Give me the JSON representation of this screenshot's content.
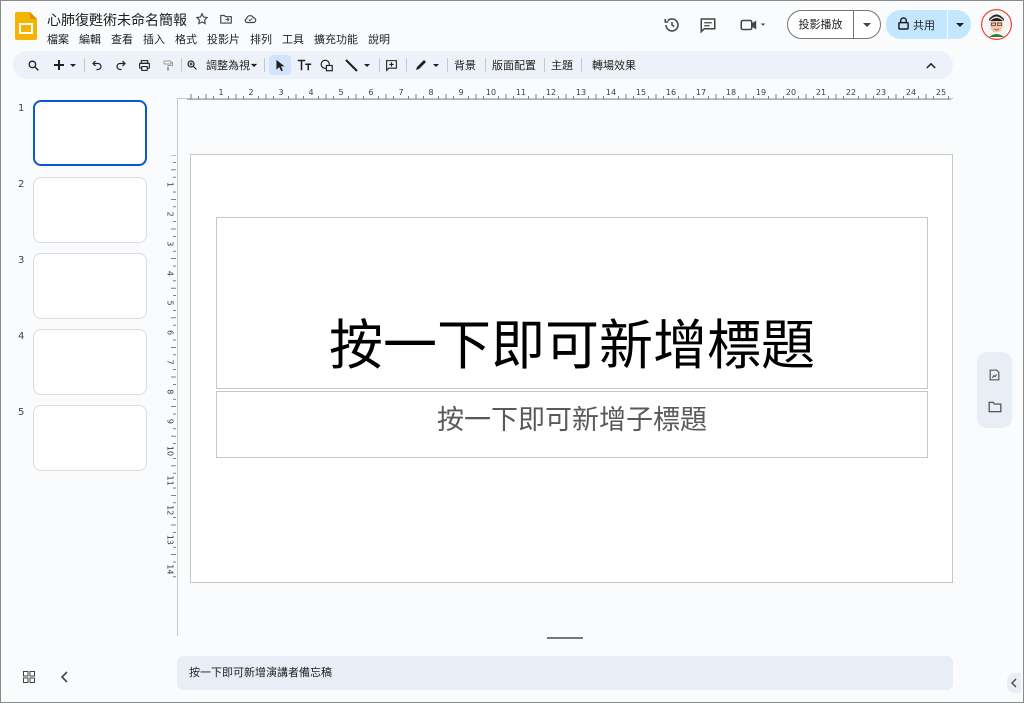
{
  "app": {
    "doc_title": "心肺復甦術未命名簡報",
    "menu": [
      "檔案",
      "編輯",
      "查看",
      "插入",
      "格式",
      "投影片",
      "排列",
      "工具",
      "擴充功能",
      "說明"
    ]
  },
  "header": {
    "present_label": "投影播放",
    "share_label": "共用",
    "accent": "#c2e7ff"
  },
  "toolbar": {
    "zoom_label": "調整為視",
    "background_label": "背景",
    "layout_label": "版面配置",
    "theme_label": "主題",
    "transition_label": "轉場效果"
  },
  "filmstrip": {
    "slides": [
      {
        "num": "1",
        "selected": true
      },
      {
        "num": "2",
        "selected": false
      },
      {
        "num": "3",
        "selected": false
      },
      {
        "num": "4",
        "selected": false
      },
      {
        "num": "5",
        "selected": false
      }
    ]
  },
  "rulers": {
    "horizontal": [
      "1",
      "2",
      "3",
      "4",
      "5",
      "6",
      "7",
      "8",
      "9",
      "10",
      "11",
      "12",
      "13",
      "14",
      "15",
      "16",
      "17",
      "18",
      "19",
      "20",
      "21",
      "22",
      "23",
      "24",
      "25"
    ],
    "vertical": [
      "1",
      "2",
      "3",
      "4",
      "5",
      "6",
      "7",
      "8",
      "9",
      "10",
      "11",
      "12",
      "13",
      "14"
    ]
  },
  "slide": {
    "title_placeholder": "按一下即可新增標題",
    "subtitle_placeholder": "按一下即可新增子標題"
  },
  "notes": {
    "placeholder": "按一下即可新增演講者備忘稿"
  },
  "colors": {
    "selected_border": "#0b57d0",
    "toolbar_bg": "#edf2fa",
    "page_bg": "#f9fbfd"
  }
}
